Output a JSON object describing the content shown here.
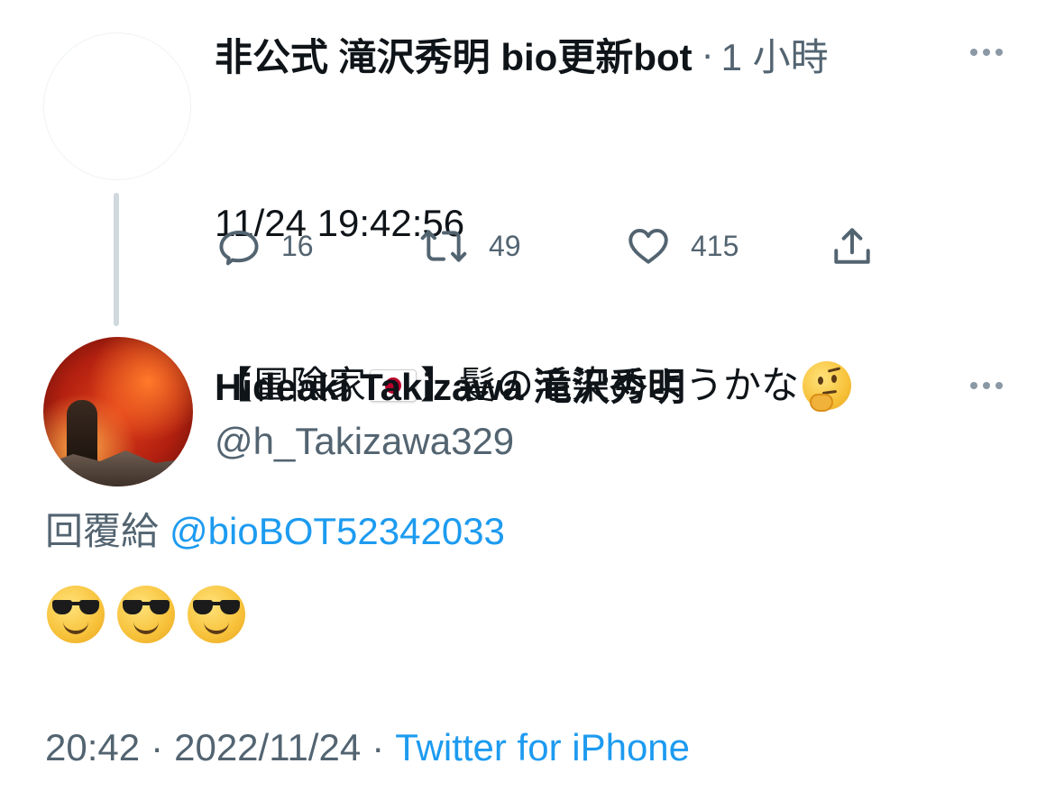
{
  "parent_tweet": {
    "author_name": "非公式 滝沢秀明 bio更新bot",
    "separator": "·",
    "relative_time": "1 小時",
    "line1": "11/24 19:42:56",
    "line2_open": "【冒険家",
    "line2_close": "】髪の毛染めようかな",
    "flag_icon": "japan-flag-emoji",
    "thinking_icon": "thinking-face-emoji",
    "actions": {
      "replies": "16",
      "retweets": "49",
      "likes": "415"
    }
  },
  "main_tweet": {
    "author_name": "Hideaki Takizawa 滝沢秀明",
    "handle": "@h_Takizawa329",
    "reply_prefix": "回覆給",
    "reply_to_handle": "@bioBOT52342033",
    "emojis": [
      "smiling-face-with-sunglasses",
      "smiling-face-with-sunglasses",
      "smiling-face-with-sunglasses"
    ],
    "timestamp_time": "20:42",
    "timestamp_date": "2022/11/24",
    "separator": "·",
    "client": "Twitter for iPhone"
  },
  "colors": {
    "text_primary": "#0f1419",
    "text_secondary": "#536471",
    "link": "#1d9bf0",
    "thread_line": "#cfd9de"
  }
}
